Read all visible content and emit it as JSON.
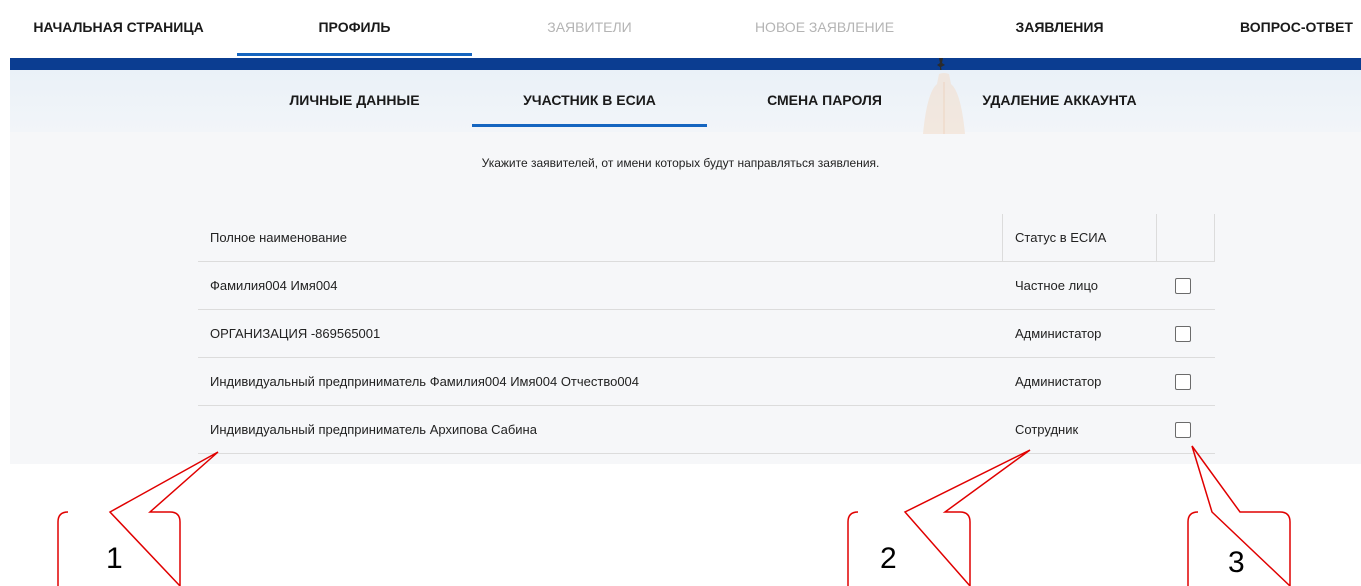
{
  "topnav": {
    "items": [
      {
        "label": "НАЧАЛЬНАЯ СТРАНИЦА",
        "state": "normal"
      },
      {
        "label": "ПРОФИЛЬ",
        "state": "active"
      },
      {
        "label": "ЗАЯВИТЕЛИ",
        "state": "disabled"
      },
      {
        "label": "НОВОЕ ЗАЯВЛЕНИЕ",
        "state": "disabled"
      },
      {
        "label": "ЗАЯВЛЕНИЯ",
        "state": "normal"
      },
      {
        "label": "ВОПРОС-ОТВЕТ",
        "state": "normal"
      }
    ]
  },
  "subnav": {
    "items": [
      {
        "label": "ЛИЧНЫЕ ДАННЫЕ",
        "state": "normal"
      },
      {
        "label": "УЧАСТНИК В ЕСИА",
        "state": "active"
      },
      {
        "label": "СМЕНА ПАРОЛЯ",
        "state": "normal"
      },
      {
        "label": "УДАЛЕНИЕ АККАУНТА",
        "state": "normal"
      }
    ]
  },
  "instruction": "Укажите заявителей, от имени которых будут направляться заявления.",
  "table": {
    "headers": {
      "name": "Полное наименование",
      "status": "Статус в ЕСИА",
      "select": ""
    },
    "rows": [
      {
        "name": "Фамилия004 Имя004",
        "status": "Частное лицо",
        "checked": false
      },
      {
        "name": "ОРГАНИЗАЦИЯ -869565001",
        "status": "Администатор",
        "checked": false
      },
      {
        "name": "Индивидуальный предприниматель Фамилия004 Имя004 Отчество004",
        "status": "Администатор",
        "checked": false
      },
      {
        "name": "Индивидуальный предприниматель Архипова Сабина",
        "status": "Сотрудник",
        "checked": false
      }
    ]
  },
  "callouts": [
    {
      "number": "1"
    },
    {
      "number": "2"
    },
    {
      "number": "3"
    }
  ],
  "colors": {
    "accent": "#1565c0",
    "band": "#0b3d91",
    "callout": "#e00000",
    "disabled_text": "#b4b4b4"
  }
}
